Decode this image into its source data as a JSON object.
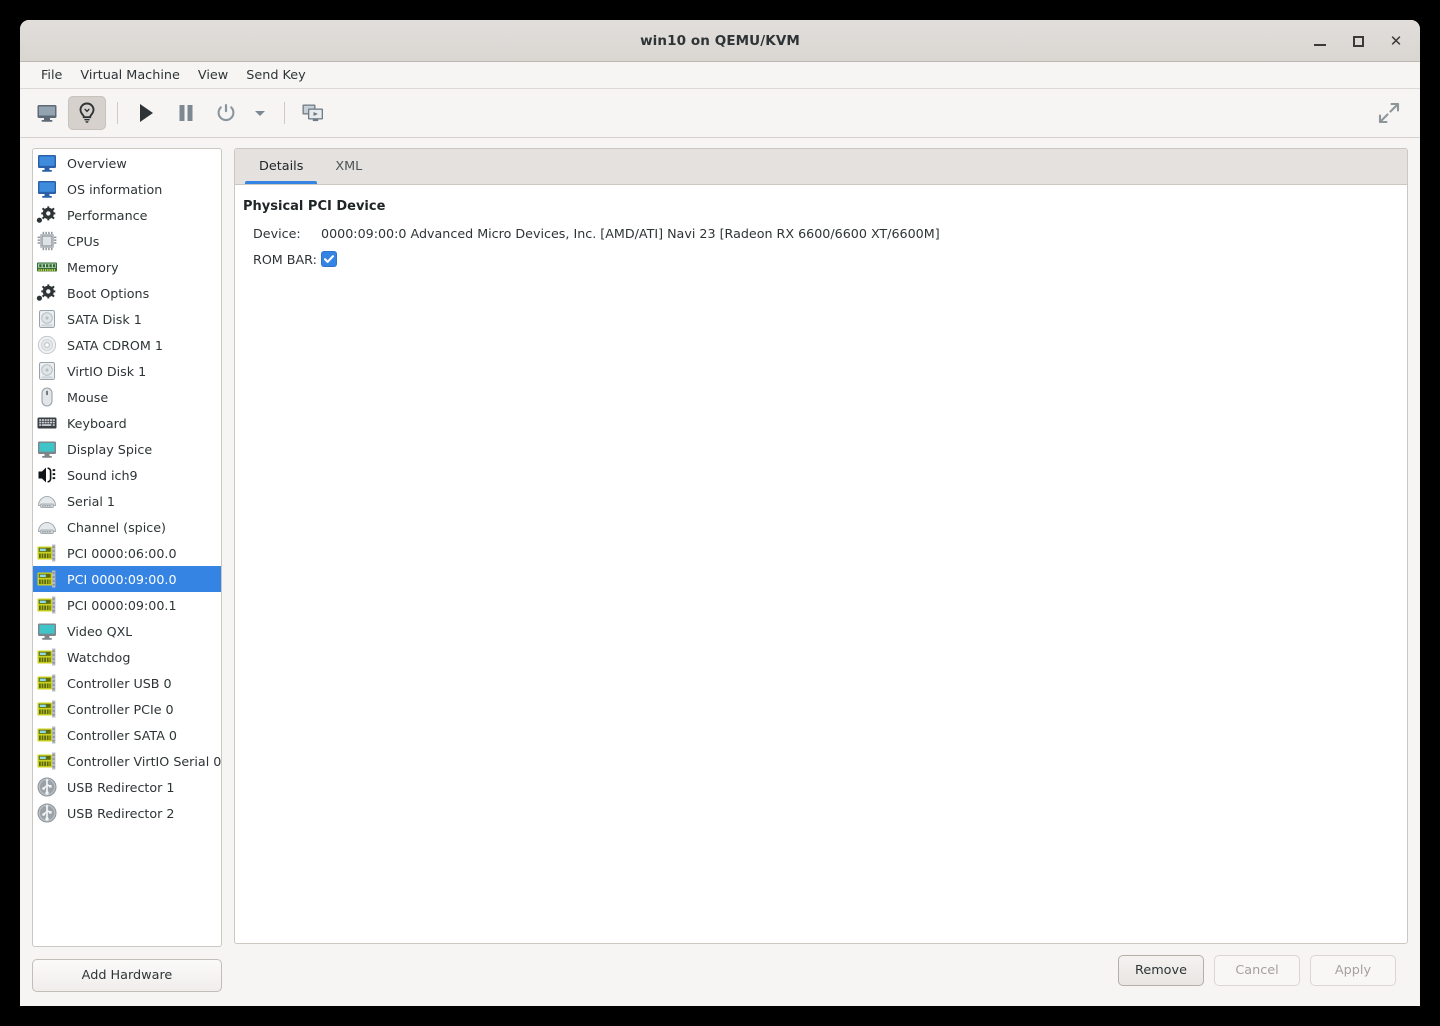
{
  "window": {
    "title": "win10 on QEMU/KVM",
    "controls": [
      {
        "name": "minimize",
        "label": "—"
      },
      {
        "name": "maximize",
        "label": "□"
      },
      {
        "name": "close",
        "label": "✕"
      }
    ]
  },
  "menubar": {
    "items": [
      {
        "label": "File"
      },
      {
        "label": "Virtual Machine"
      },
      {
        "label": "View"
      },
      {
        "label": "Send Key"
      }
    ]
  },
  "toolbar": {
    "buttons": [
      {
        "name": "show-console-button",
        "icon": "monitor-icon",
        "active": false
      },
      {
        "name": "show-hardware-details-button",
        "icon": "lightbulb-icon",
        "active": true
      },
      {
        "name": "run-button",
        "icon": "play-icon",
        "active": false
      },
      {
        "name": "pause-button",
        "icon": "pause-icon",
        "active": false
      },
      {
        "name": "shutdown-button",
        "icon": "power-icon",
        "active": false
      },
      {
        "name": "shutdown-menu-button",
        "icon": "chevron-down-icon",
        "active": false
      },
      {
        "name": "snapshots-button",
        "icon": "screens-icon",
        "active": false
      }
    ],
    "fullscreen": {
      "name": "fullscreen-button",
      "icon": "expand-arrows-icon"
    }
  },
  "sidebar": {
    "items": [
      {
        "label": "Overview",
        "icon": "monitor-icon"
      },
      {
        "label": "OS information",
        "icon": "monitor-icon"
      },
      {
        "label": "Performance",
        "icon": "gear-icon"
      },
      {
        "label": "CPUs",
        "icon": "cpu-chip-icon"
      },
      {
        "label": "Memory",
        "icon": "memory-stick-icon"
      },
      {
        "label": "Boot Options",
        "icon": "gear-icon"
      },
      {
        "label": "SATA Disk 1",
        "icon": "harddisk-icon"
      },
      {
        "label": "SATA CDROM 1",
        "icon": "cdrom-icon"
      },
      {
        "label": "VirtIO Disk 1",
        "icon": "harddisk-icon"
      },
      {
        "label": "Mouse",
        "icon": "mouse-icon"
      },
      {
        "label": "Keyboard",
        "icon": "keyboard-icon"
      },
      {
        "label": "Display Spice",
        "icon": "display-icon"
      },
      {
        "label": "Sound ich9",
        "icon": "sound-icon"
      },
      {
        "label": "Serial 1",
        "icon": "serial-port-icon"
      },
      {
        "label": "Channel (spice)",
        "icon": "serial-port-icon"
      },
      {
        "label": "PCI 0000:06:00.0",
        "icon": "pci-card-icon"
      },
      {
        "label": "PCI 0000:09:00.0",
        "icon": "pci-card-icon",
        "selected": true
      },
      {
        "label": "PCI 0000:09:00.1",
        "icon": "pci-card-icon"
      },
      {
        "label": "Video QXL",
        "icon": "display-icon"
      },
      {
        "label": "Watchdog",
        "icon": "pci-card-icon"
      },
      {
        "label": "Controller USB 0",
        "icon": "pci-card-icon"
      },
      {
        "label": "Controller PCIe 0",
        "icon": "pci-card-icon"
      },
      {
        "label": "Controller SATA 0",
        "icon": "pci-card-icon"
      },
      {
        "label": "Controller VirtIO Serial 0",
        "icon": "pci-card-icon"
      },
      {
        "label": "USB Redirector 1",
        "icon": "usb-icon"
      },
      {
        "label": "USB Redirector 2",
        "icon": "usb-icon"
      }
    ],
    "add_hardware_label": "Add Hardware"
  },
  "main": {
    "tabs": [
      {
        "label": "Details",
        "active": true
      },
      {
        "label": "XML",
        "active": false
      }
    ],
    "section_title": "Physical PCI Device",
    "fields": [
      {
        "label": "Device:",
        "value": "0000:09:00:0 Advanced Micro Devices, Inc. [AMD/ATI] Navi 23 [Radeon RX 6600/6600 XT/6600M]"
      }
    ],
    "rom_bar": {
      "label": "ROM BAR:",
      "checked": true
    }
  },
  "footer": {
    "buttons": [
      {
        "label": "Remove",
        "disabled": false
      },
      {
        "label": "Cancel",
        "disabled": true
      },
      {
        "label": "Apply",
        "disabled": true
      }
    ]
  },
  "colors": {
    "accent": "#3584e4",
    "window_bg": "#f6f5f4",
    "titlebar_bg": "#dad6d2",
    "panel_bg": "#ffffff",
    "text": "#2e3436"
  }
}
